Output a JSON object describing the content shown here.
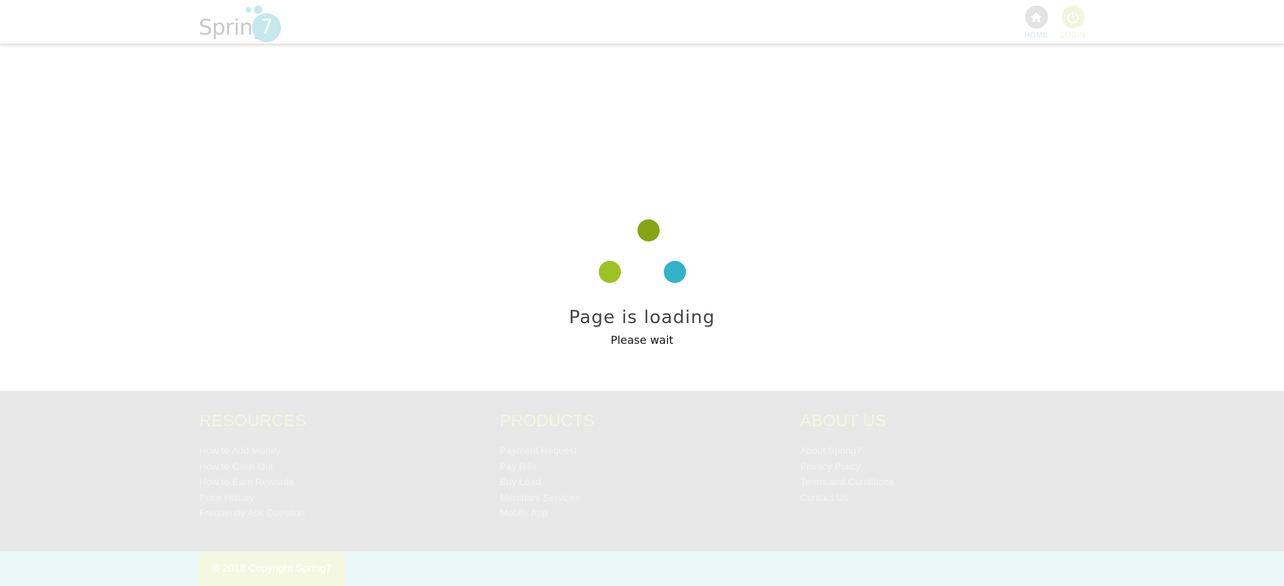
{
  "header": {
    "logo_text": "Spring",
    "logo_number": "7",
    "nav": [
      {
        "label": "HOME",
        "icon": "home-icon"
      },
      {
        "label": "LOGIN",
        "icon": "power-icon"
      }
    ]
  },
  "loader": {
    "title": "Page is loading",
    "subtitle": "Please wait",
    "colors": {
      "dot_top": "#84a415",
      "dot_left": "#9dc225",
      "dot_right": "#32b3c7"
    }
  },
  "footer": {
    "columns": [
      {
        "title": "RESOURCES",
        "links": [
          "How to Add Money",
          "How to Cash Out",
          "How to Earn Rewards",
          "Price History",
          "Frequently Ask Question"
        ]
      },
      {
        "title": "PRODUCTS",
        "links": [
          "Payment Request",
          "Pay Bills",
          "Buy Load",
          "Merchant Services",
          "Mobile App"
        ]
      },
      {
        "title": "ABOUT US",
        "links": [
          "About Spring7",
          "Privacy Policy",
          "Terms and Conditions",
          "Contact Us"
        ]
      }
    ],
    "copyright": "© 2018 Copyright Spring7"
  }
}
